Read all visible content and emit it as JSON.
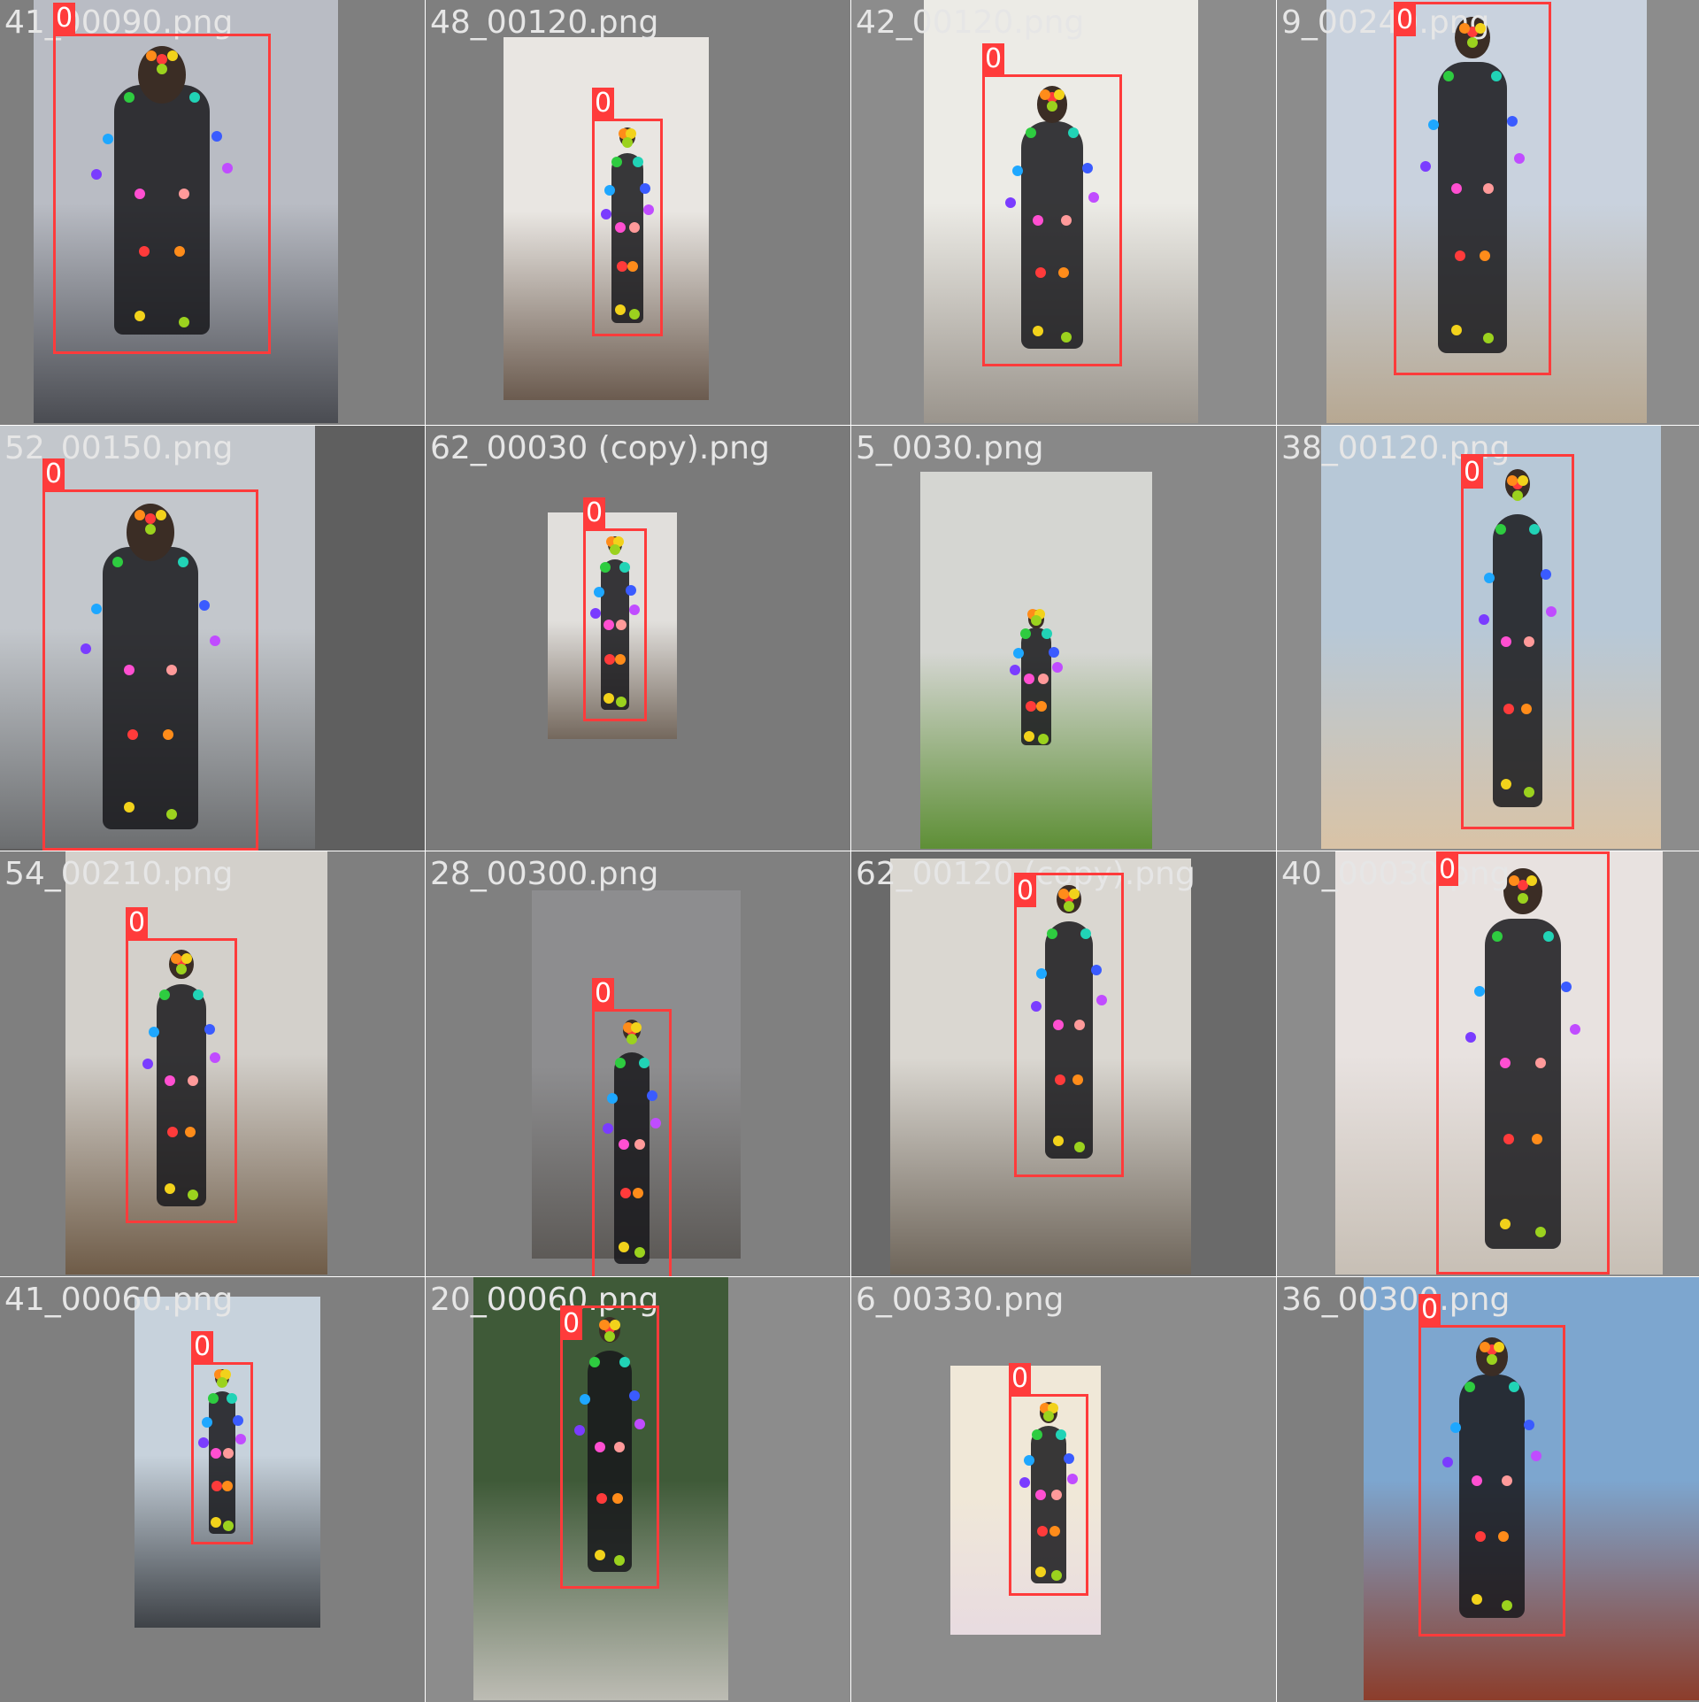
{
  "tiles": [
    {
      "file": "41_00090.png",
      "label": "0",
      "bg": "#7f7f7f",
      "photo": [
        "#b9bcc4",
        "#4a4c52"
      ]
    },
    {
      "file": "48_00120.png",
      "label": "0",
      "bg": "#7f7f7f",
      "photo": [
        "#e9e6e2",
        "#6b5b4f"
      ]
    },
    {
      "file": "42_00120.png",
      "label": "0",
      "bg": "#8c8c8c",
      "photo": [
        "#ecebe6",
        "#9a948c"
      ]
    },
    {
      "file": "9_00240.png",
      "label": "0",
      "bg": "#8c8c8c",
      "photo": [
        "#c9d2de",
        "#b7a892"
      ]
    },
    {
      "file": "52_00150.png",
      "label": "0",
      "bg": "#5f5f5f",
      "photo": [
        "#c3c7cc",
        "#6c6e70"
      ]
    },
    {
      "file": "62_00030 (copy).png",
      "label": "0",
      "bg": "#7a7a7a",
      "photo": [
        "#e1dfdc",
        "#74685d"
      ]
    },
    {
      "file": "5_0030.png",
      "label": "",
      "bg": "#888888",
      "photo": [
        "#d5d6d2",
        "#5e8f36"
      ]
    },
    {
      "file": "38_00120.png",
      "label": "0",
      "bg": "#8c8c8c",
      "photo": [
        "#b7c8d7",
        "#d9c3a6"
      ]
    },
    {
      "file": "54_00210.png",
      "label": "0",
      "bg": "#7f7f7f",
      "photo": [
        "#d3d0cb",
        "#6f5c48"
      ]
    },
    {
      "file": "28_00300.png",
      "label": "0",
      "bg": "#808080",
      "photo": [
        "#8d8d8f",
        "#5d5a57"
      ]
    },
    {
      "file": "62_00120 (copy).png",
      "label": "0",
      "bg": "#6a6a6a",
      "photo": [
        "#dad7d1",
        "#6e655a"
      ]
    },
    {
      "file": "40_00030.png",
      "label": "0",
      "bg": "#8c8c8c",
      "photo": [
        "#e8e2e0",
        "#c7bfb5"
      ]
    },
    {
      "file": "41_00060.png",
      "label": "0",
      "bg": "#7f7f7f",
      "photo": [
        "#c7d2dc",
        "#3e4247"
      ]
    },
    {
      "file": "20_00060.png",
      "label": "0",
      "bg": "#8c8c8c",
      "photo": [
        "#3f5a38",
        "#bdbcb4"
      ]
    },
    {
      "file": "6_00330.png",
      "label": "0",
      "bg": "#8c8c8c",
      "photo": [
        "#f0e8d8",
        "#e8dbe0"
      ]
    },
    {
      "file": "36_00300.png",
      "label": "0",
      "bg": "#7f7f7f",
      "photo": [
        "#7da6cf",
        "#8c3d2b"
      ]
    }
  ],
  "keypoint_colors": [
    "#ff3b3b",
    "#ff8c1a",
    "#f2d21b",
    "#9bd21e",
    "#2ecc40",
    "#21d3b6",
    "#1ea7ff",
    "#3a5bff",
    "#7a3cff",
    "#c04cff",
    "#ff4fd1",
    "#ff9a9a"
  ]
}
